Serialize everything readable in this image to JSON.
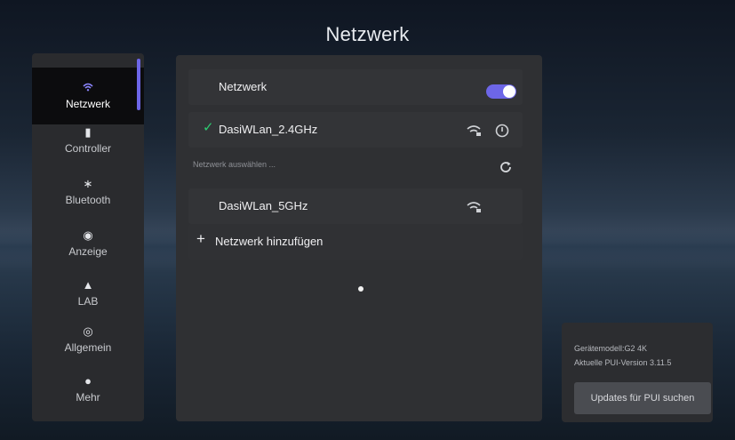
{
  "window": {
    "title": "Netzwerk"
  },
  "sidebar": {
    "items": [
      {
        "label": "Netzwerk",
        "icon": "wifi-icon",
        "active": true
      },
      {
        "label": "Controller",
        "icon": "controller-icon",
        "active": false
      },
      {
        "label": "Bluetooth",
        "icon": "bluetooth-icon",
        "active": false
      },
      {
        "label": "Anzeige",
        "icon": "eye-icon",
        "active": false
      },
      {
        "label": "LAB",
        "icon": "flask-icon",
        "active": false
      },
      {
        "label": "Allgemein",
        "icon": "general-icon",
        "active": false
      },
      {
        "label": "Mehr",
        "icon": "more-icon",
        "active": false
      }
    ]
  },
  "network": {
    "toggle_label": "Netzwerk",
    "toggle_on": true,
    "connected_network": "DasiWLan_2.4GHz",
    "select_label": "Netzwerk auswählen ...",
    "available_networks": [
      {
        "name": "DasiWLan_5GHz"
      }
    ],
    "add_network_label": "Netzwerk hinzufügen"
  },
  "device_info": {
    "model_line": "Gerätemodell:G2 4K",
    "version_line": "Aktuelle PUI-Version 3.11.5",
    "update_button": "Updates für PUI suchen"
  },
  "colors": {
    "accent": "#6d66e8",
    "check": "#2ecc71"
  }
}
